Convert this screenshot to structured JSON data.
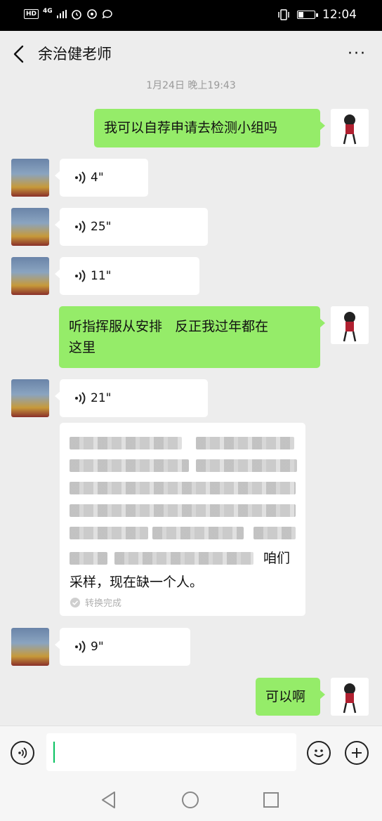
{
  "status_bar": {
    "left_indicators": [
      "HD",
      "4G"
    ],
    "time": "12:04"
  },
  "header": {
    "title": "余治健老师",
    "back_icon": "chevron-left-icon",
    "more_label": "···"
  },
  "timestamp": "1月24日 晚上19:43",
  "messages": [
    {
      "from": "me",
      "type": "text",
      "text": "我可以自荐申请去检测小组吗"
    },
    {
      "from": "other",
      "type": "voice",
      "duration": "4\""
    },
    {
      "from": "other",
      "type": "voice",
      "duration": "25\""
    },
    {
      "from": "other",
      "type": "voice",
      "duration": "11\""
    },
    {
      "from": "me",
      "type": "text",
      "lines": [
        "听指挥服从安排   反正我过年都在",
        "这里"
      ]
    },
    {
      "from": "other",
      "type": "voice",
      "duration": "21\""
    },
    {
      "from": "other",
      "type": "voice",
      "duration": "9\""
    },
    {
      "from": "me",
      "type": "text",
      "text": "可以啊"
    }
  ],
  "transcript": {
    "visible_end": "咱们",
    "last_line": "采样，现在缺一个人。",
    "status": "转换完成"
  },
  "input_bar": {
    "voice_icon": "voice-mode-icon",
    "emoji_icon": "emoji-icon",
    "plus_icon": "plus-icon",
    "value": ""
  },
  "colors": {
    "my_bubble": "#95ec69",
    "their_bubble": "#ffffff",
    "background": "#ededed",
    "caret": "#07c160"
  }
}
